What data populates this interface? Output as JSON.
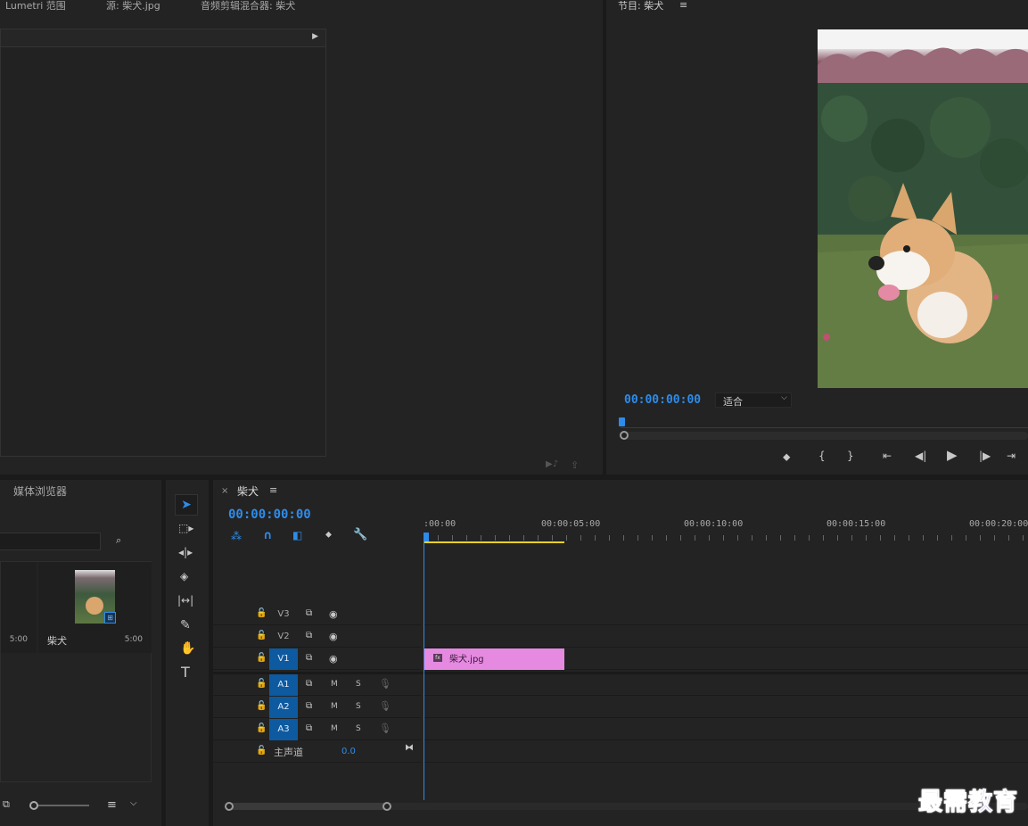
{
  "source_area": {
    "tabs": [
      "Lumetri 范围",
      "源: 柴犬.jpg",
      "音频剪辑混合器: 柴犬"
    ]
  },
  "program_monitor": {
    "title": "节目: 柴犬",
    "timecode": "00:00:00:00",
    "fit_select": "适合"
  },
  "project_panel": {
    "tab": "媒体浏览器",
    "items": [
      {
        "name": "",
        "duration": "5:00"
      },
      {
        "name": "柴犬",
        "duration": "5:00"
      }
    ]
  },
  "timeline": {
    "sequence_name": "柴犬",
    "timecode": "00:00:00:00",
    "ruler": [
      ":00:00",
      "00:00:05:00",
      "00:00:10:00",
      "00:00:15:00",
      "00:00:20:00"
    ],
    "video_tracks": [
      "V3",
      "V2",
      "V1"
    ],
    "audio_tracks": [
      "A1",
      "A2",
      "A3"
    ],
    "mute": "M",
    "solo": "S",
    "master_label": "主声道",
    "master_value": "0.0",
    "clip_name": "柴犬.jpg",
    "clip_color": "#e58ae0"
  },
  "watermark": "最需教育"
}
